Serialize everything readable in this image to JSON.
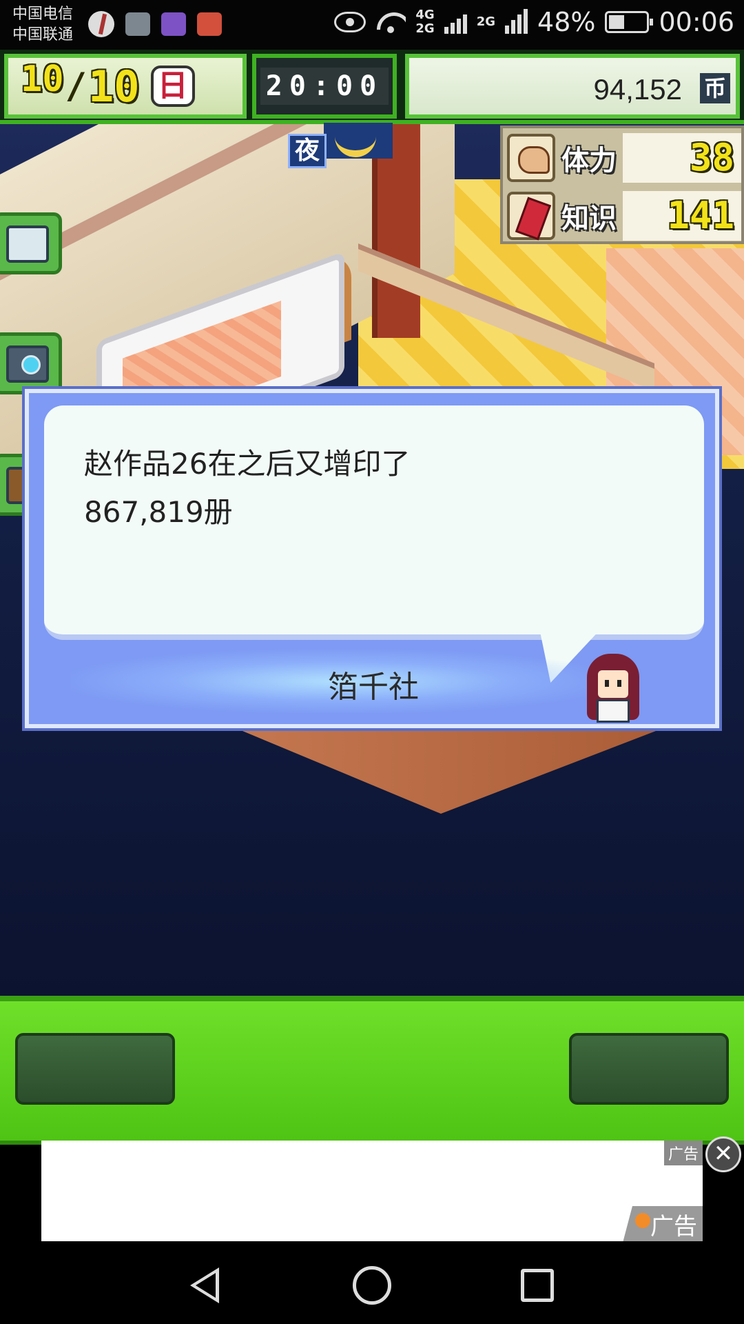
{
  "status_bar": {
    "carrier_1": "中国电信",
    "carrier_2": "中国联通",
    "network_top": "4G",
    "network_bottom": "2G",
    "network_2": "2G",
    "battery": "48%",
    "time": "00:06"
  },
  "hud": {
    "month": "10",
    "slash": "/",
    "day": "10",
    "weekday": "日",
    "clock": "20:00",
    "money": "94,152",
    "currency_symbol": "币"
  },
  "world": {
    "time_of_day": "夜"
  },
  "stats": [
    {
      "label": "体力",
      "value": "38",
      "icon": "muscle-icon"
    },
    {
      "label": "知识",
      "value": "141",
      "icon": "book-icon"
    }
  ],
  "dialog": {
    "message_line_1": "赵作品26在之后又增印了",
    "message_line_2": "867,819册",
    "speaker": "箔千社"
  },
  "ad": {
    "tag_top": "广告",
    "tag_bottom": "广告",
    "close_label": "✕"
  },
  "colors": {
    "hud_green": "#3fb122",
    "dialog_blue": "#7e9af4",
    "bottom_bar_green": "#5fd21e",
    "stat_value_gold": "#f2c418"
  }
}
